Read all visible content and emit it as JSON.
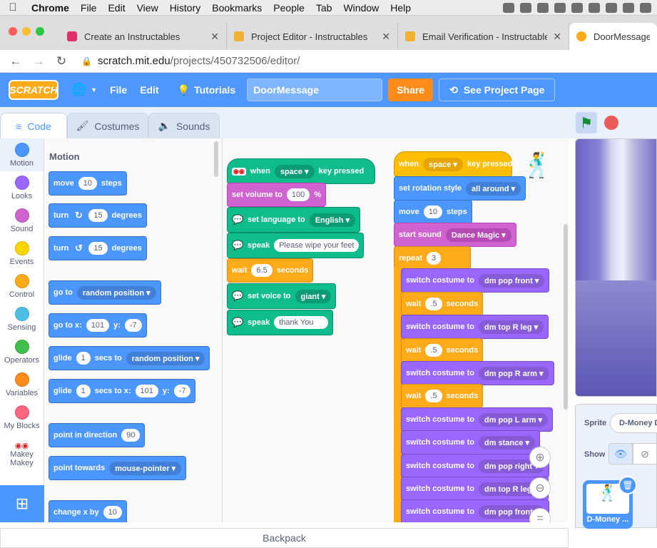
{
  "mac_menu": {
    "app": "Chrome",
    "items": [
      "File",
      "Edit",
      "View",
      "History",
      "Bookmarks",
      "People",
      "Tab",
      "Window",
      "Help"
    ]
  },
  "browser_tabs": [
    {
      "title": "Create an Instructables",
      "color": "#e0306b"
    },
    {
      "title": "Project Editor - Instructables",
      "color": "#f0b030"
    },
    {
      "title": "Email Verification - Instructables",
      "color": "#f0b030"
    },
    {
      "title": "DoorMessage on Scratch",
      "color": "#ffab19"
    }
  ],
  "address": {
    "host": "scratch.mit.edu",
    "path": "/projects/450732506/editor/"
  },
  "scratch_menu": {
    "logo": "SCRATCH",
    "file": "File",
    "edit": "Edit",
    "tutorials": "Tutorials",
    "project_title": "DoorMessage",
    "share": "Share",
    "see_page": "See Project Page"
  },
  "editor_tabs": {
    "code": "Code",
    "costumes": "Costumes",
    "sounds": "Sounds"
  },
  "categories": [
    {
      "label": "Motion",
      "color": "#4c97ff"
    },
    {
      "label": "Looks",
      "color": "#9966ff"
    },
    {
      "label": "Sound",
      "color": "#cf63cf"
    },
    {
      "label": "Events",
      "color": "#ffd500"
    },
    {
      "label": "Control",
      "color": "#ffab19"
    },
    {
      "label": "Sensing",
      "color": "#4cbfe6"
    },
    {
      "label": "Operators",
      "color": "#40bf4a"
    },
    {
      "label": "Variables",
      "color": "#ff8c1a"
    },
    {
      "label": "My Blocks",
      "color": "#ff6680"
    },
    {
      "label": "Makey Makey",
      "color": "#0fbd8c"
    }
  ],
  "palette": {
    "title": "Motion",
    "move": {
      "pre": "move",
      "val": "10",
      "post": "steps"
    },
    "turn_cw": {
      "pre": "turn",
      "val": "15",
      "post": "degrees"
    },
    "turn_ccw": {
      "pre": "turn",
      "val": "15",
      "post": "degrees"
    },
    "goto": {
      "pre": "go to",
      "dd": "random position"
    },
    "gotoxy": {
      "pre": "go to x:",
      "x": "101",
      "ymid": "y:",
      "y": "-7"
    },
    "glide": {
      "pre": "glide",
      "val": "1",
      "mid": "secs to",
      "dd": "random position"
    },
    "glidexy": {
      "pre": "glide",
      "val": "1",
      "mid": "secs to x:",
      "x": "101",
      "ymid": "y:",
      "y": "-7"
    },
    "point_dir": {
      "pre": "point in direction",
      "val": "90"
    },
    "point_towards": {
      "pre": "point towards",
      "dd": "mouse-pointer"
    },
    "change_x": {
      "pre": "change x by",
      "val": "10"
    }
  },
  "script1": {
    "when": {
      "pre": "when",
      "dd": "space",
      "post": "key pressed"
    },
    "volume": {
      "pre": "set volume to",
      "val": "100",
      "post": "%"
    },
    "language": {
      "pre": "set language to",
      "dd": "English"
    },
    "speak1": {
      "pre": "speak",
      "val": "Please wipe your feet"
    },
    "wait": {
      "pre": "wait",
      "val": "6.5",
      "post": "seconds"
    },
    "voice": {
      "pre": "set voice to",
      "dd": "giant"
    },
    "speak2": {
      "pre": "speak",
      "val": "thank You"
    }
  },
  "script2": {
    "when": {
      "pre": "when",
      "dd": "space",
      "post": "key pressed"
    },
    "rotation": {
      "pre": "set rotation style",
      "dd": "all around"
    },
    "move": {
      "pre": "move",
      "val": "10",
      "post": "steps"
    },
    "sound": {
      "pre": "start sound",
      "dd": "Dance Magic"
    },
    "repeat": {
      "pre": "repeat",
      "val": "3"
    },
    "costume_pre": "switch costume to",
    "wait_pre": "wait",
    "wait_post": "seconds",
    "costumes": [
      "dm pop front",
      "dm top R leg",
      "dm pop R arm",
      "dm pop L arm",
      "dm stance",
      "dm pop right",
      "dm top R leg",
      "dm pop front"
    ],
    "waits": [
      ".5",
      ".5",
      ".5"
    ]
  },
  "backpack": "Backpack",
  "sprite_panel": {
    "sprite_label": "Sprite",
    "sprite_name": "D-Money Dance",
    "show_label": "Show",
    "thumb_name": "D-Money ..."
  }
}
